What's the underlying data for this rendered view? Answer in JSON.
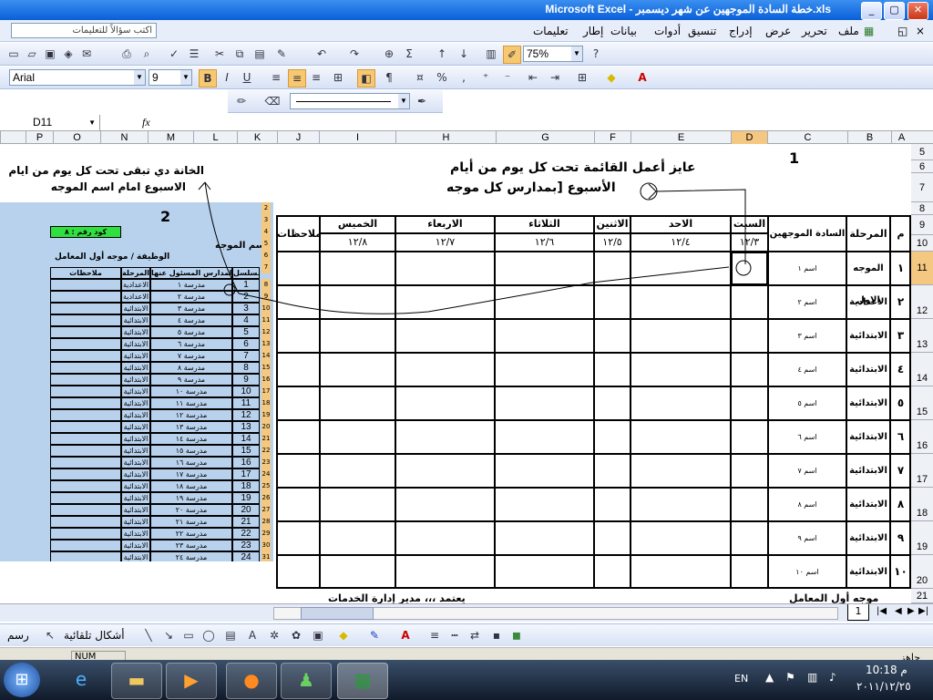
{
  "window": {
    "title": "Microsoft Excel - خطة السادة الموجهين عن شهر ديسمبر.xls",
    "min_glyph": "_",
    "max_glyph": "▢",
    "close_glyph": "✕"
  },
  "menubar": {
    "items": [
      "ملف",
      "تحرير",
      "عرض",
      "إدراج",
      "تنسيق",
      "أدوات",
      "بيانات",
      "إطار",
      "تعليمات"
    ],
    "help_placeholder": "اكتب سؤالاً للتعليمات"
  },
  "toolbar": {
    "zoom": "75%",
    "font_name": "Arial",
    "font_size": "9",
    "bold": "B",
    "italic": "I",
    "underline": "U",
    "percent": "%",
    "comma": ",",
    "sigma": "Σ"
  },
  "formula": {
    "name_box": "D11",
    "fx": "fx"
  },
  "columns_main": [
    "A",
    "B",
    "C",
    "D",
    "E",
    "F",
    "G",
    "H",
    "I",
    "J"
  ],
  "columns_left": [
    "K",
    "L",
    "M",
    "N",
    "O",
    "P"
  ],
  "rows": [
    "5",
    "6",
    "7",
    "8",
    "9",
    "10",
    "11",
    "12",
    "13",
    "14",
    "15",
    "16",
    "17",
    "18",
    "19",
    "20",
    "21"
  ],
  "annotations": {
    "label_1": "1",
    "label_2": "2",
    "request_line1": "عايز أعمل القائمة تحت كل يوم من أيام",
    "request_line2": "الأسبوع [بمدارس كل موجه",
    "note_line1": "الخانة دي تبقى تحت كل يوم من ايام",
    "note_line2": "الاسبوع امام اسم الموجه"
  },
  "main_table": {
    "headers": {
      "num": "م",
      "stage": "المرحلة",
      "supervisors": "السادة الموجهين",
      "sat": "السبت",
      "sun": "الاحد",
      "mon": "الاثنين",
      "tue": "الثلاثاء",
      "wed": "الاربعاء",
      "thu": "الخميس",
      "notes": "ملاحظات"
    },
    "dates": {
      "sat": "١٢/٣",
      "sun": "١٢/٤",
      "mon": "١٢/٥",
      "tue": "١٢/٦",
      "wed": "١٢/٧",
      "thu": "١٢/٨"
    },
    "rows": [
      {
        "num": "١",
        "stage": "الموجه الاول",
        "name": "اسم ١"
      },
      {
        "num": "٢",
        "stage": "الاعدادية",
        "name": "اسم ٢"
      },
      {
        "num": "٣",
        "stage": "الابتدائية",
        "name": "اسم ٣"
      },
      {
        "num": "٤",
        "stage": "الابتدائية",
        "name": "اسم ٤"
      },
      {
        "num": "٥",
        "stage": "الابتدائية",
        "name": "اسم ٥"
      },
      {
        "num": "٦",
        "stage": "الابتدائية",
        "name": "اسم ٦"
      },
      {
        "num": "٧",
        "stage": "الابتدائية",
        "name": "اسم ٧"
      },
      {
        "num": "٨",
        "stage": "الابتدائية",
        "name": "اسم ٨"
      },
      {
        "num": "٩",
        "stage": "الابتدائية",
        "name": "اسم ٩"
      },
      {
        "num": "١٠",
        "stage": "الابتدائية",
        "name": "اسم ١٠"
      }
    ],
    "footer_left": "يعتمد ،،، مدير إدارة الخدمات",
    "footer_right": "موجه أول المعامل"
  },
  "inset": {
    "code_label": "كود رقم : ٨",
    "supervisor_label": "أسم الموجه",
    "job_label": "الوظيفة / موجه أول المعامل",
    "col_serial": "مسلسل",
    "col_school": "اسم المدارس المسئول عنها",
    "col_stage": "المرحلة",
    "col_notes": "ملاحظات",
    "row_numbers_top": [
      "2",
      "3",
      "4",
      "5",
      "6",
      "7"
    ],
    "rows": [
      {
        "n": "1",
        "school": "مدرسة ١",
        "stage": "الاعدادية",
        "r": "8"
      },
      {
        "n": "2",
        "school": "مدرسة ٢",
        "stage": "الاعدادية",
        "r": "9"
      },
      {
        "n": "3",
        "school": "مدرسة ٣",
        "stage": "الابتدائية",
        "r": "10"
      },
      {
        "n": "4",
        "school": "مدرسة ٤",
        "stage": "الابتدائية",
        "r": "11"
      },
      {
        "n": "5",
        "school": "مدرسة ٥",
        "stage": "الابتدائية",
        "r": "12"
      },
      {
        "n": "6",
        "school": "مدرسة ٦",
        "stage": "الابتدائية",
        "r": "13"
      },
      {
        "n": "7",
        "school": "مدرسة ٧",
        "stage": "الابتدائية",
        "r": "14"
      },
      {
        "n": "8",
        "school": "مدرسة ٨",
        "stage": "الابتدائية",
        "r": "15"
      },
      {
        "n": "9",
        "school": "مدرسة ٩",
        "stage": "الابتدائية",
        "r": "16"
      },
      {
        "n": "10",
        "school": "مدرسة ١٠",
        "stage": "الابتدائية",
        "r": "17"
      },
      {
        "n": "11",
        "school": "مدرسة ١١",
        "stage": "الابتدائية",
        "r": "18"
      },
      {
        "n": "12",
        "school": "مدرسة ١٢",
        "stage": "الابتدائية",
        "r": "19"
      },
      {
        "n": "13",
        "school": "مدرسة ١٣",
        "stage": "الابتدائية",
        "r": "20"
      },
      {
        "n": "14",
        "school": "مدرسة ١٤",
        "stage": "الابتدائية",
        "r": "21"
      },
      {
        "n": "15",
        "school": "مدرسة ١٥",
        "stage": "الابتدائية",
        "r": "22"
      },
      {
        "n": "16",
        "school": "مدرسة ١٦",
        "stage": "الابتدائية",
        "r": "23"
      },
      {
        "n": "17",
        "school": "مدرسة ١٧",
        "stage": "الابتدائية",
        "r": "24"
      },
      {
        "n": "18",
        "school": "مدرسة ١٨",
        "stage": "الابتدائية",
        "r": "25"
      },
      {
        "n": "19",
        "school": "مدرسة ١٩",
        "stage": "الابتدائية",
        "r": "26"
      },
      {
        "n": "20",
        "school": "مدرسة ٢٠",
        "stage": "الابتدائية",
        "r": "27"
      },
      {
        "n": "21",
        "school": "مدرسة ٢١",
        "stage": "الابتدائية",
        "r": "28"
      },
      {
        "n": "22",
        "school": "مدرسة ٢٢",
        "stage": "الابتدائية",
        "r": "29"
      },
      {
        "n": "23",
        "school": "مدرسة ٢٣",
        "stage": "الابتدائية",
        "r": "30"
      },
      {
        "n": "24",
        "school": "مدرسة ٢٤",
        "stage": "الابتدائية",
        "r": "31"
      }
    ]
  },
  "sheet_tab": "1",
  "drawing": {
    "draw_label": "رسم",
    "autoshapes_label": "أشكال تلقائية"
  },
  "status": {
    "ready": "جاهز",
    "num": "NUM"
  },
  "taskbar": {
    "lang": "EN",
    "time": "10:18 م",
    "date": "٢٠١١/١٢/٢٥"
  }
}
